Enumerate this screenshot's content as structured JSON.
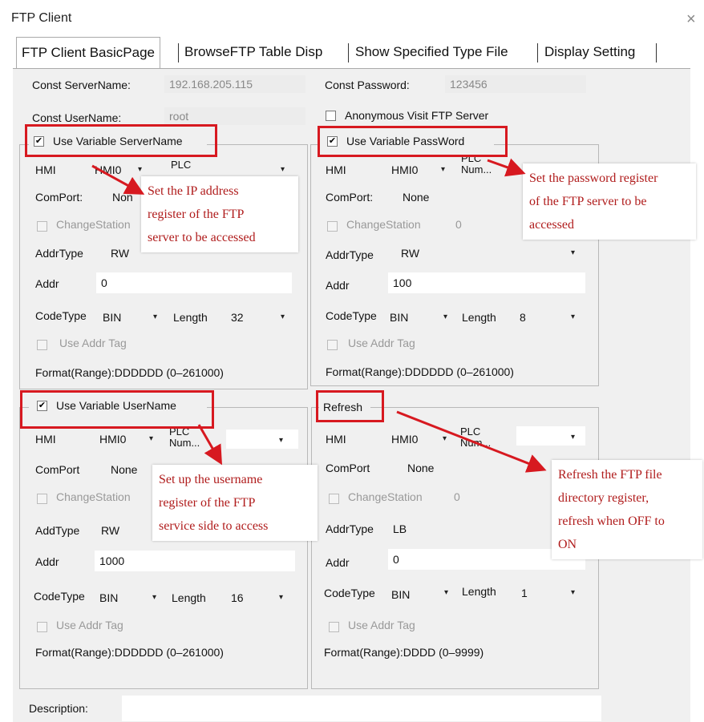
{
  "window": {
    "title": "FTP Client",
    "close_glyph": "×"
  },
  "tabs": [
    {
      "label": "FTP Client BasicPage"
    },
    {
      "label": "BrowseFTP Table Disp"
    },
    {
      "label": "Show Specified Type File"
    },
    {
      "label": "Display Setting"
    }
  ],
  "top": {
    "server_label": "Const ServerName:",
    "server_value": "192.168.205.115",
    "user_label": "Const UserName:",
    "user_value": "root",
    "password_label": "Const Password:",
    "password_value": "123456",
    "anonymous_label": "Anonymous Visit FTP Server",
    "anonymous_checked": false
  },
  "groups": {
    "server": {
      "check_label": "Use Variable ServerName",
      "checked": true,
      "hmi_label": "HMI",
      "hmi_value": "HMI0",
      "plc_label": "PLC",
      "comport_label": "ComPort:",
      "comport_value": "Non",
      "change_station_label": "ChangeStation",
      "addrtype_label": "AddrType",
      "addrtype_value": "RW",
      "addr_label": "Addr",
      "addr_value": "0",
      "codetype_label": "CodeType",
      "codetype_value": "BIN",
      "length_label": "Length",
      "length_value": "32",
      "use_addr_tag_label": "Use Addr Tag",
      "format": "Format(Range):DDDDDD (0–261000)"
    },
    "password": {
      "check_label": "Use Variable PassWord",
      "checked": true,
      "hmi_label": "HMI",
      "hmi_value": "HMI0",
      "plc_label": "PLC\nNum...",
      "comport_label": "ComPort:",
      "comport_value": "None",
      "change_station_label": "ChangeStation",
      "station_value": "0",
      "addrtype_label": "AddrType",
      "addrtype_value": "RW",
      "addr_label": "Addr",
      "addr_value": "100",
      "codetype_label": "CodeType",
      "codetype_value": "BIN",
      "length_label": "Length",
      "length_value": "8",
      "use_addr_tag_label": "Use Addr Tag",
      "format": "Format(Range):DDDDDD (0–261000)"
    },
    "username": {
      "check_label": "Use Variable UserName",
      "checked": true,
      "hmi_label": "HMI",
      "hmi_value": "HMI0",
      "plc_label": "PLC\nNum...",
      "comport_label": "ComPort",
      "comport_value": "None",
      "change_station_label": "ChangeStation",
      "addrtype_label": "AddType",
      "addrtype_value": "RW",
      "addr_label": "Addr",
      "addr_value": "1000",
      "codetype_label": "CodeType",
      "codetype_value": "BIN",
      "length_label": "Length",
      "length_value": "16",
      "use_addr_tag_label": "Use Addr Tag",
      "format": "Format(Range):DDDDDD (0–261000)"
    },
    "refresh": {
      "title": "Refresh",
      "hmi_label": "HMI",
      "hmi_value": "HMI0",
      "plc_label": "PLC\nNum...",
      "comport_label": "ComPort",
      "comport_value": "None",
      "change_station_label": "ChangeStation",
      "station_value": "0",
      "addrtype_label": "AddrType",
      "addrtype_value": "LB",
      "addr_label": "Addr",
      "addr_value": "0",
      "codetype_label": "CodeType",
      "codetype_value": "BIN",
      "length_label": "Length",
      "length_value": "1",
      "use_addr_tag_label": "Use Addr Tag",
      "format": "Format(Range):DDDD (0–9999)"
    }
  },
  "description_label": "Description:",
  "callouts": {
    "server": [
      "Set the IP address",
      "register of the FTP",
      "server to be accessed"
    ],
    "password": [
      "Set the password register",
      "of the FTP server to be",
      "accessed"
    ],
    "username": [
      "Set up the username",
      "register of the FTP",
      "service side to access"
    ],
    "refresh": [
      "Refresh the FTP file",
      "directory register,",
      "refresh when OFF to",
      "ON"
    ]
  },
  "annotation_color": "#d71920",
  "check_glyph": "✔",
  "dropdown_glyph": "▾"
}
